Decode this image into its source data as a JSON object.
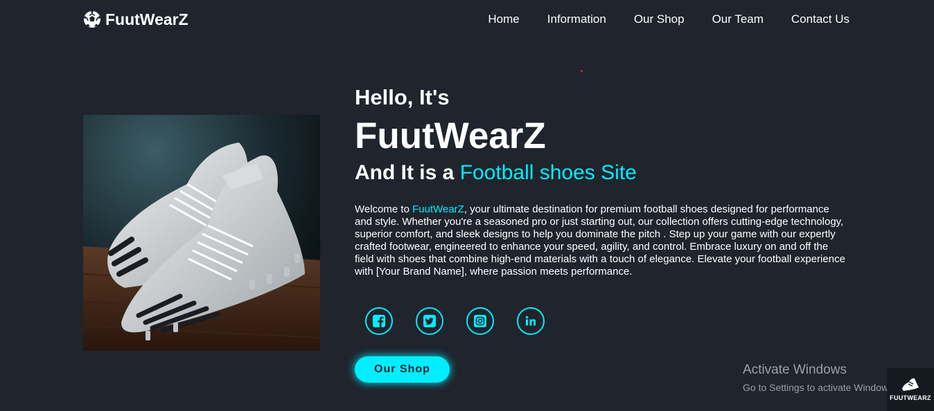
{
  "header": {
    "logo_text": "FuutWearZ",
    "logo_icon": "soccer-ball-icon",
    "nav": [
      "Home",
      "Information",
      "Our Shop",
      "Our Team",
      "Contact Us"
    ]
  },
  "hero": {
    "image_alt": "White football boots with black stripes on wooden floor",
    "hello": "Hello, It's",
    "brand": "FuutWearZ",
    "tagline_prefix": "And It is a ",
    "tagline_accent": "Football shoes Site",
    "desc_prefix": "Welcome to ",
    "desc_brand": "FuutWearZ",
    "desc_body": ", your ultimate destination for premium football shoes designed for performance and style. Whether you're a seasoned pro or just starting out, our collection offers cutting-edge technology, superior comfort, and sleek designs to help you dominate the pitch . Step up your game with our expertly crafted footwear, engineered to enhance your speed, agility, and control. Embrace luxury on and off the field with shoes that combine high-end materials with a touch of elegance. Elevate your football experience with [Your Brand Name], where passion meets performance.",
    "socials": [
      "facebook-icon",
      "twitter-icon",
      "instagram-icon",
      "linkedin-icon"
    ],
    "shop_button": "Our Shop"
  },
  "watermark": {
    "title": "Activate Windows",
    "subtitle": "Go to Settings to activate Windows."
  },
  "corner_badge": {
    "text": "FUUTWEARZ"
  },
  "colors": {
    "background": "#1f242d",
    "accent": "#00eeff",
    "text": "#ffffff"
  }
}
